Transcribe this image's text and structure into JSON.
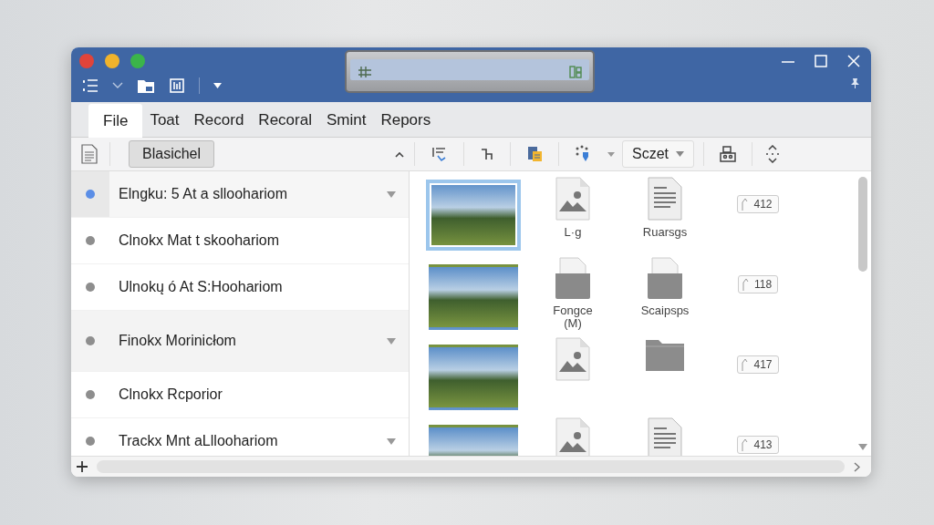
{
  "window": {
    "tabs": [
      {
        "label": "File",
        "selected": true
      },
      {
        "label": "Toat",
        "selected": false
      },
      {
        "label": "Record",
        "selected": false
      },
      {
        "label": "Recoral",
        "selected": false
      },
      {
        "label": "Smint",
        "selected": false
      },
      {
        "label": "Repors",
        "selected": false
      }
    ]
  },
  "toolbar": {
    "view_button": "Blasichel",
    "select_button": "Sczet"
  },
  "sidebar": {
    "items": [
      {
        "label": "Elngku: 5 At a slloohariom",
        "selected": true,
        "highlighted": false,
        "expandable": true
      },
      {
        "label": "Clnokx Mat t skoohariom",
        "selected": false,
        "highlighted": false,
        "expandable": false
      },
      {
        "label": "Ulnokų ó At S:Hoohariom",
        "selected": false,
        "highlighted": false,
        "expandable": false
      },
      {
        "label": "Finokx Morinicłom",
        "selected": false,
        "highlighted": true,
        "expandable": true
      },
      {
        "label": "Clnokx Rcporior",
        "selected": false,
        "highlighted": false,
        "expandable": false
      },
      {
        "label": "Trackx Mnt aLlloohariom",
        "selected": false,
        "highlighted": false,
        "expandable": true
      }
    ]
  },
  "grid": {
    "rows": [
      [
        {
          "kind": "photo",
          "selected": true
        },
        {
          "kind": "image-file",
          "label": "L·g"
        },
        {
          "kind": "document",
          "label": "Ruarsgs"
        },
        {
          "kind": "tag",
          "label": "412"
        }
      ],
      [
        {
          "kind": "photo",
          "selected": false
        },
        {
          "kind": "folder-file",
          "label": "Fongce (M)"
        },
        {
          "kind": "folder-file",
          "label": "Scaipsps"
        },
        {
          "kind": "tag",
          "label": "118"
        }
      ],
      [
        {
          "kind": "photo",
          "selected": false
        },
        {
          "kind": "image-file"
        },
        {
          "kind": "folder"
        },
        {
          "kind": "tag",
          "label": "417"
        }
      ],
      [
        {
          "kind": "photo",
          "selected": false
        },
        {
          "kind": "image-file"
        },
        {
          "kind": "document"
        },
        {
          "kind": "tag",
          "label": "413"
        }
      ]
    ]
  }
}
